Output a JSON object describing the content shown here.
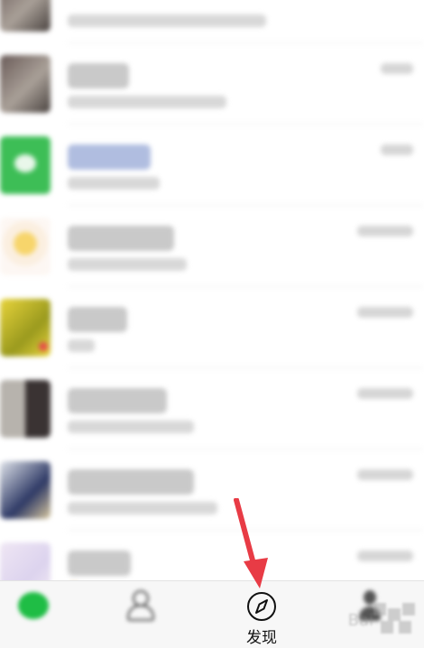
{
  "tabbar": {
    "discover_label": "发现"
  },
  "colors": {
    "accent_green": "#1fbd45",
    "annotation_red": "#e83b45"
  },
  "icons": {
    "chats": "chat-bubble-icon",
    "contacts": "contacts-icon",
    "discover": "compass-icon",
    "me": "person-icon"
  }
}
